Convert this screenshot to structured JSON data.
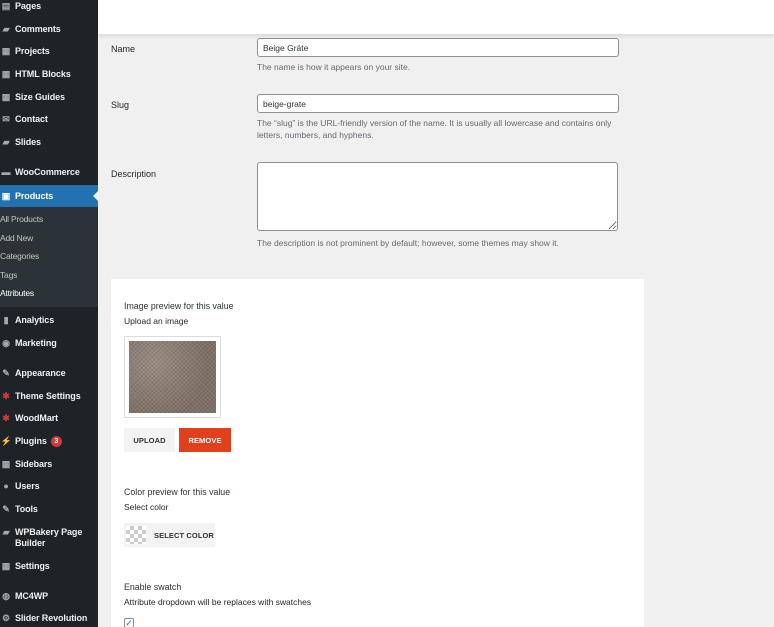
{
  "sidebar": {
    "menu": [
      {
        "label": "Pages",
        "icon": "pages-icon",
        "glyph": "▤"
      },
      {
        "label": "Comments",
        "icon": "comments-icon",
        "glyph": "▰"
      },
      {
        "label": "Projects",
        "icon": "projects-icon",
        "glyph": "▦"
      },
      {
        "label": "HTML Blocks",
        "icon": "html-blocks-icon",
        "glyph": "▦"
      },
      {
        "label": "Size Guides",
        "icon": "size-guides-icon",
        "glyph": "▦"
      },
      {
        "label": "Contact",
        "icon": "contact-icon",
        "glyph": "✉"
      },
      {
        "label": "Slides",
        "icon": "slides-icon",
        "glyph": "▰"
      },
      {
        "label": "WooCommerce",
        "icon": "woocommerce-icon",
        "glyph": "▬"
      },
      {
        "label": "Products",
        "icon": "products-icon",
        "glyph": "▣"
      },
      {
        "label": "Analytics",
        "icon": "analytics-icon",
        "glyph": "▮"
      },
      {
        "label": "Marketing",
        "icon": "marketing-icon",
        "glyph": "◉"
      },
      {
        "label": "Appearance",
        "icon": "appearance-icon",
        "glyph": "✎"
      },
      {
        "label": "Theme Settings",
        "icon": "theme-settings-icon",
        "glyph": "✱"
      },
      {
        "label": "WoodMart",
        "icon": "woodmart-icon",
        "glyph": "✱"
      },
      {
        "label": "Plugins",
        "icon": "plugins-icon",
        "glyph": "⚡",
        "badge": "3"
      },
      {
        "label": "Sidebars",
        "icon": "sidebars-icon",
        "glyph": "▦"
      },
      {
        "label": "Users",
        "icon": "users-icon",
        "glyph": "●"
      },
      {
        "label": "Tools",
        "icon": "tools-icon",
        "glyph": "✎"
      },
      {
        "label": "WPBakery Page Builder",
        "icon": "wpbakery-icon",
        "glyph": "▰"
      },
      {
        "label": "Settings",
        "icon": "settings-icon",
        "glyph": "▦"
      },
      {
        "label": "MC4WP",
        "icon": "mc4wp-icon",
        "glyph": "◍"
      },
      {
        "label": "Slider Revolution",
        "icon": "slider-revolution-icon",
        "glyph": "⚙"
      }
    ],
    "submenu": [
      "All Products",
      "Add New",
      "Categories",
      "Tags",
      "Attributes"
    ]
  },
  "form": {
    "name_label": "Name",
    "name_value": "Beige Gräte",
    "name_desc": "The name is how it appears on your site.",
    "slug_label": "Slug",
    "slug_value": "beige-grate",
    "slug_desc": "The “slug” is the URL-friendly version of the name. It is usually all lowercase and contains only letters, numbers, and hyphens.",
    "description_label": "Description",
    "description_value": "",
    "description_desc": "The description is not prominent by default; however, some themes may show it."
  },
  "panel": {
    "image_heading": "Image preview for this value",
    "image_sub": "Upload an image",
    "upload_label": "Upload",
    "remove_label": "Remove",
    "color_heading": "Color preview for this value",
    "color_sub": "Select color",
    "select_color_label": "Select color",
    "swatch_heading": "Enable swatch",
    "swatch_sub": "Attribute dropdown will be replaces with swatches",
    "swatch_checked": true
  },
  "colors": {
    "sidebar_bg": "#1d2327",
    "active": "#2271b1",
    "remove_button": "#e2401c",
    "badge": "#d63638"
  }
}
